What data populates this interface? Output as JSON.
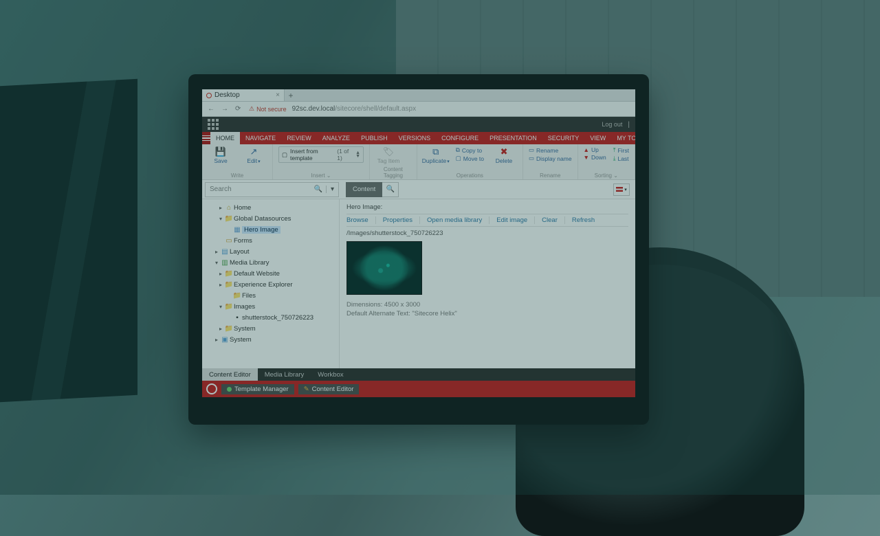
{
  "browser": {
    "tab_title": "Desktop",
    "not_secure": "Not secure",
    "url_host": "92sc.dev.local",
    "url_path": "/sitecore/shell/default.aspx"
  },
  "header": {
    "logout": "Log out"
  },
  "ribbon_tabs": [
    "HOME",
    "NAVIGATE",
    "REVIEW",
    "ANALYZE",
    "PUBLISH",
    "VERSIONS",
    "CONFIGURE",
    "PRESENTATION",
    "SECURITY",
    "VIEW",
    "MY TOOLBAR"
  ],
  "ribbon": {
    "write": {
      "save": "Save",
      "edit": "Edit",
      "group": "Write"
    },
    "insert": {
      "from_template": "Insert from template",
      "page": "(1 of 1)",
      "group": "Insert"
    },
    "tagging": {
      "tag": "Tag Item",
      "group": "Content Tagging"
    },
    "operations": {
      "duplicate": "Duplicate",
      "copy_to": "Copy to",
      "move_to": "Move to",
      "delete": "Delete",
      "group": "Operations"
    },
    "rename": {
      "rename": "Rename",
      "display_name": "Display name",
      "group": "Rename"
    },
    "sorting": {
      "up": "Up",
      "down": "Down",
      "first": "First",
      "last": "Last",
      "group": "Sorting"
    }
  },
  "search": {
    "placeholder": "Search",
    "content_tab": "Content"
  },
  "tree": {
    "home": "Home",
    "global": "Global Datasources",
    "hero": "Hero Image",
    "forms": "Forms",
    "layout": "Layout",
    "media": "Media Library",
    "default_site": "Default Website",
    "exp": "Experience Explorer",
    "files": "Files",
    "images": "Images",
    "shutter": "shutterstock_750726223",
    "system1": "System",
    "system2": "System"
  },
  "pane": {
    "section": "Hero Image:",
    "actions": [
      "Browse",
      "Properties",
      "Open media library",
      "Edit image",
      "Clear",
      "Refresh"
    ],
    "path": "/Images/shutterstock_750726223",
    "dim": "Dimensions: 4500 x 3000",
    "alt": "Default Alternate Text: \"Sitecore Helix\""
  },
  "bottom_tabs": [
    "Content Editor",
    "Media Library",
    "Workbox"
  ],
  "footer": {
    "template_manager": "Template Manager",
    "content_editor": "Content Editor"
  }
}
